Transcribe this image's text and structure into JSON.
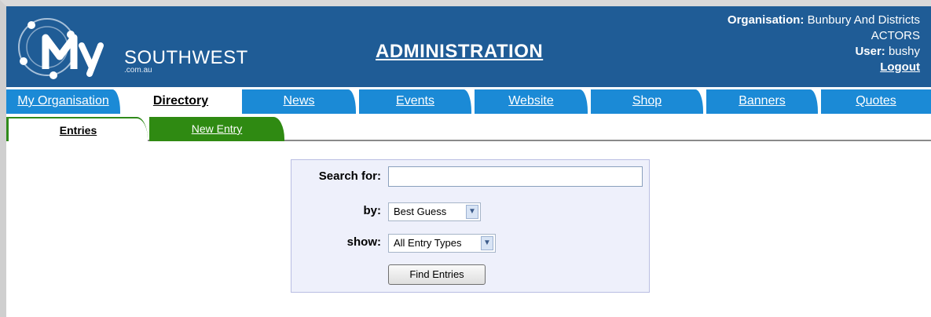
{
  "header": {
    "logo_text": "SOUTHWEST",
    "logo_sub": ".com.au",
    "title": "ADMINISTRATION",
    "org_label": "Organisation:",
    "org_name_line1": "Bunbury And Districts",
    "org_name_line2": "ACTORS",
    "user_label": "User:",
    "user_name": "bushy",
    "logout_label": "Logout"
  },
  "tabs": [
    {
      "label": "My Organisation",
      "active": false
    },
    {
      "label": "Directory",
      "active": true
    },
    {
      "label": "News",
      "active": false
    },
    {
      "label": "Events",
      "active": false
    },
    {
      "label": "Website",
      "active": false
    },
    {
      "label": "Shop",
      "active": false
    },
    {
      "label": "Banners",
      "active": false
    },
    {
      "label": "Quotes",
      "active": false
    }
  ],
  "subtabs": [
    {
      "label": "Entries",
      "active": true
    },
    {
      "label": "New Entry",
      "active": false
    }
  ],
  "search": {
    "search_for_label": "Search for:",
    "search_value": "",
    "by_label": "by:",
    "by_selected": "Best Guess",
    "show_label": "show:",
    "show_selected": "All Entry Types",
    "button_label": "Find Entries"
  },
  "colors": {
    "header_bg": "#1f5c96",
    "tab_bg": "#1b8ad6",
    "subtab_bg": "#2f8a12",
    "search_bg": "#eef0fb"
  }
}
